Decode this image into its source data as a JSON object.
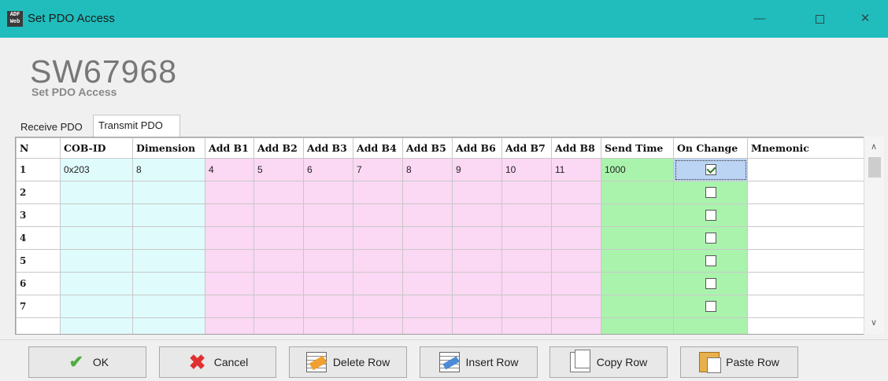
{
  "window": {
    "icon_line1": "ADF",
    "icon_line2": "Web",
    "title": "Set PDO Access",
    "minimize": "—",
    "close": "✕"
  },
  "header": {
    "device_code": "SW67968",
    "subtitle": "Set PDO Access"
  },
  "tabs": {
    "receive": "Receive PDO",
    "transmit": "Transmit PDO",
    "active": "Transmit PDO"
  },
  "table": {
    "columns": [
      "N",
      "COB-ID",
      "Dimension",
      "Add B1",
      "Add B2",
      "Add B3",
      "Add B4",
      "Add B5",
      "Add B6",
      "Add B7",
      "Add B8",
      "Send Time",
      "On Change",
      "Mnemonic"
    ],
    "rows": [
      {
        "n": "1",
        "cob_id": "0x203",
        "dimension": "8",
        "b1": "4",
        "b2": "5",
        "b3": "6",
        "b4": "7",
        "b5": "8",
        "b6": "9",
        "b7": "10",
        "b8": "11",
        "send_time": "1000",
        "on_change": true,
        "mnemonic": ""
      },
      {
        "n": "2",
        "cob_id": "",
        "dimension": "",
        "b1": "",
        "b2": "",
        "b3": "",
        "b4": "",
        "b5": "",
        "b6": "",
        "b7": "",
        "b8": "",
        "send_time": "",
        "on_change": false,
        "mnemonic": ""
      },
      {
        "n": "3",
        "cob_id": "",
        "dimension": "",
        "b1": "",
        "b2": "",
        "b3": "",
        "b4": "",
        "b5": "",
        "b6": "",
        "b7": "",
        "b8": "",
        "send_time": "",
        "on_change": false,
        "mnemonic": ""
      },
      {
        "n": "4",
        "cob_id": "",
        "dimension": "",
        "b1": "",
        "b2": "",
        "b3": "",
        "b4": "",
        "b5": "",
        "b6": "",
        "b7": "",
        "b8": "",
        "send_time": "",
        "on_change": false,
        "mnemonic": ""
      },
      {
        "n": "5",
        "cob_id": "",
        "dimension": "",
        "b1": "",
        "b2": "",
        "b3": "",
        "b4": "",
        "b5": "",
        "b6": "",
        "b7": "",
        "b8": "",
        "send_time": "",
        "on_change": false,
        "mnemonic": ""
      },
      {
        "n": "6",
        "cob_id": "",
        "dimension": "",
        "b1": "",
        "b2": "",
        "b3": "",
        "b4": "",
        "b5": "",
        "b6": "",
        "b7": "",
        "b8": "",
        "send_time": "",
        "on_change": false,
        "mnemonic": ""
      },
      {
        "n": "7",
        "cob_id": "",
        "dimension": "",
        "b1": "",
        "b2": "",
        "b3": "",
        "b4": "",
        "b5": "",
        "b6": "",
        "b7": "",
        "b8": "",
        "send_time": "",
        "on_change": false,
        "mnemonic": ""
      }
    ]
  },
  "buttons": {
    "ok": "OK",
    "cancel": "Cancel",
    "delete_row": "Delete Row",
    "insert_row": "Insert Row",
    "copy_row": "Copy Row",
    "paste_row": "Paste Row"
  },
  "colors": {
    "titlebar": "#21bdbd",
    "cob_dimension": "#e0fbfb",
    "address_bytes": "#fbd8f4",
    "send_time": "#aaf3ad",
    "selected_cell": "#bcd4f4"
  }
}
